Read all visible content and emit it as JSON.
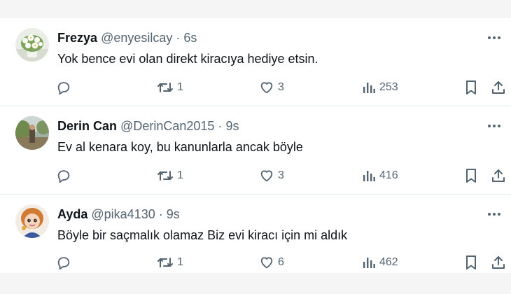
{
  "tweets": [
    {
      "name": "Frezya",
      "handle": "@enyesilcay",
      "separator": "·",
      "time": "6s",
      "text": "Yok bence evi olan direkt kiracıya hediye etsin.",
      "retweets": "1",
      "likes": "3",
      "views": "253"
    },
    {
      "name": "Derin Can",
      "handle": "@DerinCan2015",
      "separator": "·",
      "time": "9s",
      "text": "Ev al kenara koy, bu kanunlarla ancak böyle",
      "retweets": "1",
      "likes": "3",
      "views": "416"
    },
    {
      "name": "Ayda",
      "handle": "@pika4130",
      "separator": "·",
      "time": "9s",
      "text": "Böyle bir saçmalık olamaz Biz evi kiracı için mi aldık",
      "retweets": "1",
      "likes": "6",
      "views": "462"
    }
  ],
  "icons": {
    "reply": "reply-icon",
    "retweet": "retweet-icon",
    "like": "heart-icon",
    "views": "views-icon",
    "bookmark": "bookmark-icon",
    "share": "share-icon",
    "more": "more-icon"
  },
  "colors": {
    "text": "#0f1419",
    "secondary": "#536471",
    "divider": "#e6ecf0"
  }
}
